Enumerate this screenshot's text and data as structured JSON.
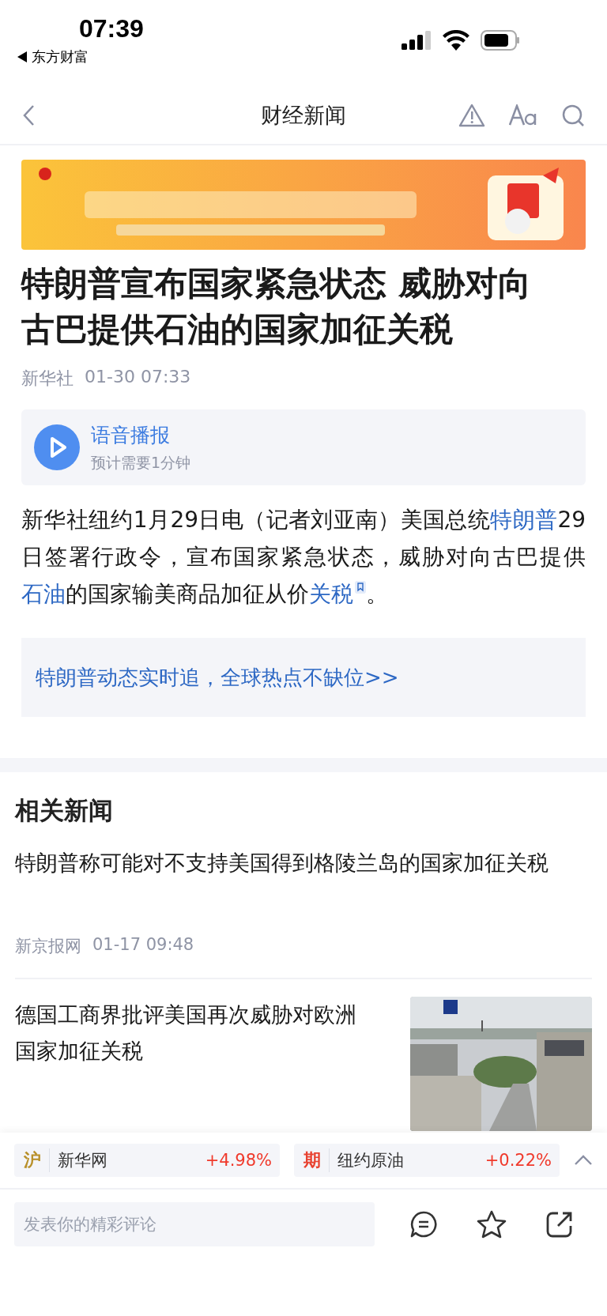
{
  "status_bar": {
    "time": "07:39",
    "back_app": "东方财富"
  },
  "nav": {
    "title": "财经新闻"
  },
  "article": {
    "headline": "特朗普宣布国家紧急状态 威胁对向古巴提供石油的国家加征关税",
    "source": "新华社",
    "time": "01-30 07:33",
    "voice": {
      "title": "语音播报",
      "subtitle": "预计需要1分钟"
    },
    "body": [
      {
        "text": "新华社纽约1月29日电（记者刘亚南）美国总统",
        "kind": "plain"
      },
      {
        "text": "特朗普",
        "kind": "link"
      },
      {
        "text": "29日签署行政令，宣布国家紧急状态，威胁对向古巴提供",
        "kind": "plain"
      },
      {
        "text": "石油",
        "kind": "link"
      },
      {
        "text": "的国家输美商品加征从价",
        "kind": "plain"
      },
      {
        "text": "关税",
        "kind": "tagged_link"
      },
      {
        "text": "。",
        "kind": "plain"
      }
    ],
    "promo_link": "特朗普动态实时追，全球热点不缺位>>"
  },
  "related": {
    "title": "相关新闻",
    "items": [
      {
        "title": "特朗普称可能对不支持美国得到格陵兰岛的国家加征关税",
        "source": "新京报网",
        "time": "01-17 09:48"
      },
      {
        "title": "德国工商界批评美国再次威胁对欧洲国家加征关税"
      }
    ]
  },
  "ticker": [
    {
      "tag": "沪",
      "color": "#b8902a",
      "name": "新华网",
      "change": "+4.98%"
    },
    {
      "tag": "期",
      "color": "#e8412f",
      "name": "纽约原油",
      "change": "+0.22%"
    }
  ],
  "comment": {
    "placeholder": "发表你的精彩评论"
  }
}
